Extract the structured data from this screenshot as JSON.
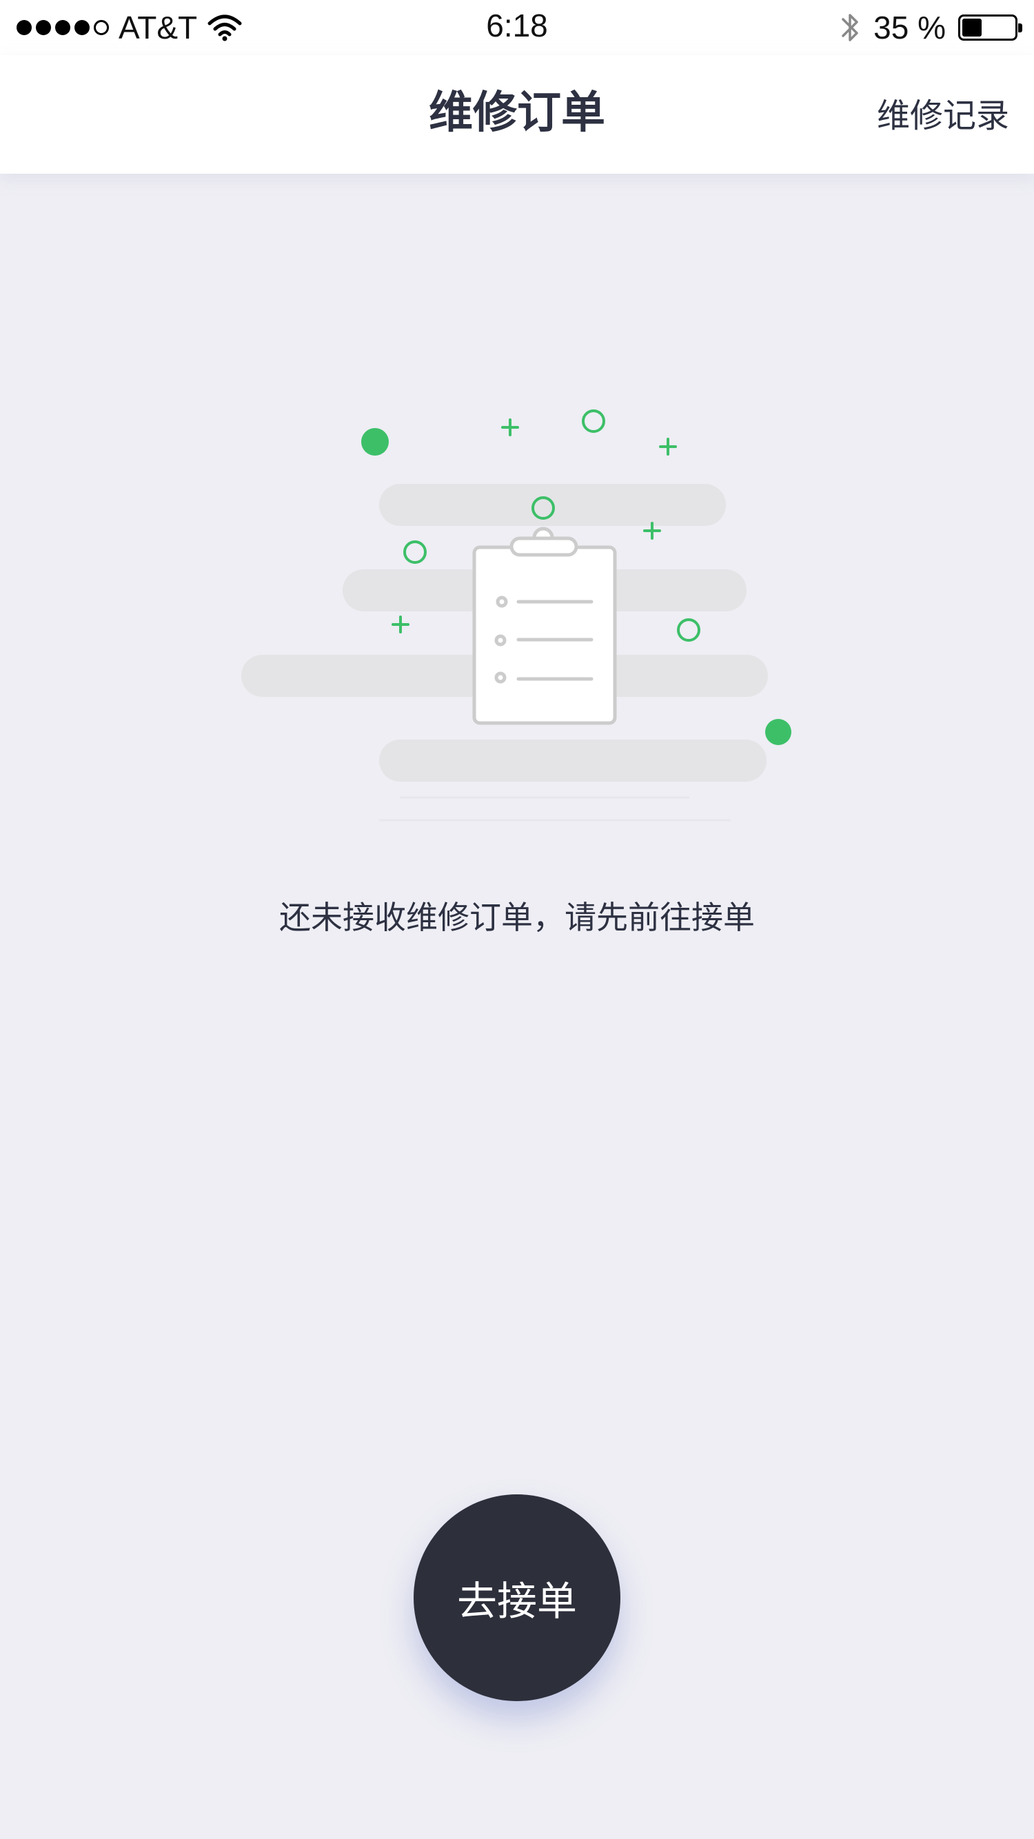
{
  "status_bar": {
    "carrier": "AT&T",
    "time": "6:18",
    "battery_text": "35 %",
    "battery_level": 0.35,
    "signal_bars_filled": 4,
    "signal_bars_total": 5,
    "icons": [
      "wifi-icon",
      "bluetooth-icon",
      "battery-icon"
    ]
  },
  "nav": {
    "title": "维修订单",
    "right_action": "维修记录"
  },
  "empty_state": {
    "message": "还未接收维修订单，请先前往接单",
    "illustration": "clipboard-illustration"
  },
  "action_button": {
    "label": "去接单"
  },
  "colors": {
    "background": "#EEEEF4",
    "accent_green": "#3DBF68",
    "dark": "#2D2F3B",
    "text": "#2D3142"
  }
}
